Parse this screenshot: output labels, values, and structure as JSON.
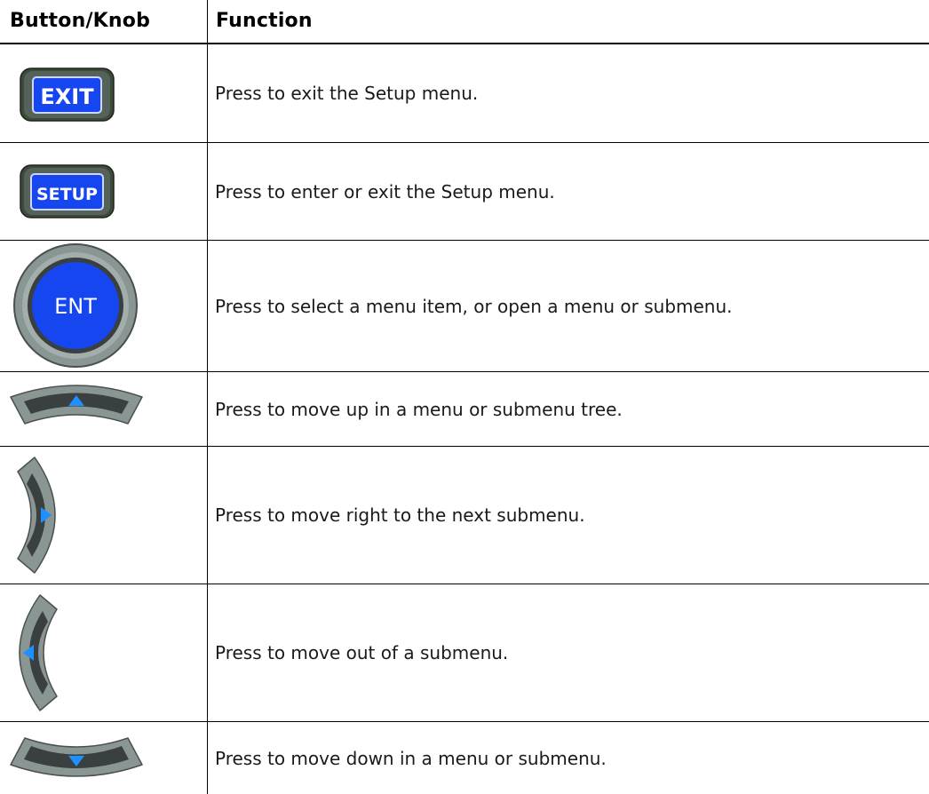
{
  "header": {
    "col_button": "Button/Knob",
    "col_function": "Function"
  },
  "rows": [
    {
      "icon": "exit-button-icon",
      "icon_text": "EXIT",
      "function": "Press to exit the Setup menu."
    },
    {
      "icon": "setup-button-icon",
      "icon_text": "SETUP",
      "function": "Press to enter or exit the Setup menu."
    },
    {
      "icon": "ent-knob-icon",
      "icon_text": "ENT",
      "function": "Press to select a menu item, or open a menu or submenu."
    },
    {
      "icon": "up-arrow-key-icon",
      "function": "Press to move up in a menu or submenu tree."
    },
    {
      "icon": "right-arrow-key-icon",
      "function": "Press to move right to the next submenu."
    },
    {
      "icon": "left-arrow-key-icon",
      "function": "Press to move out of a submenu."
    },
    {
      "icon": "down-arrow-key-icon",
      "function": "Press to move down in a menu or submenu."
    }
  ],
  "colors": {
    "button_blue": "#1646f0",
    "button_border": "#3c4a38",
    "key_gray": "#8a9694",
    "key_dark": "#3a3f3f"
  }
}
